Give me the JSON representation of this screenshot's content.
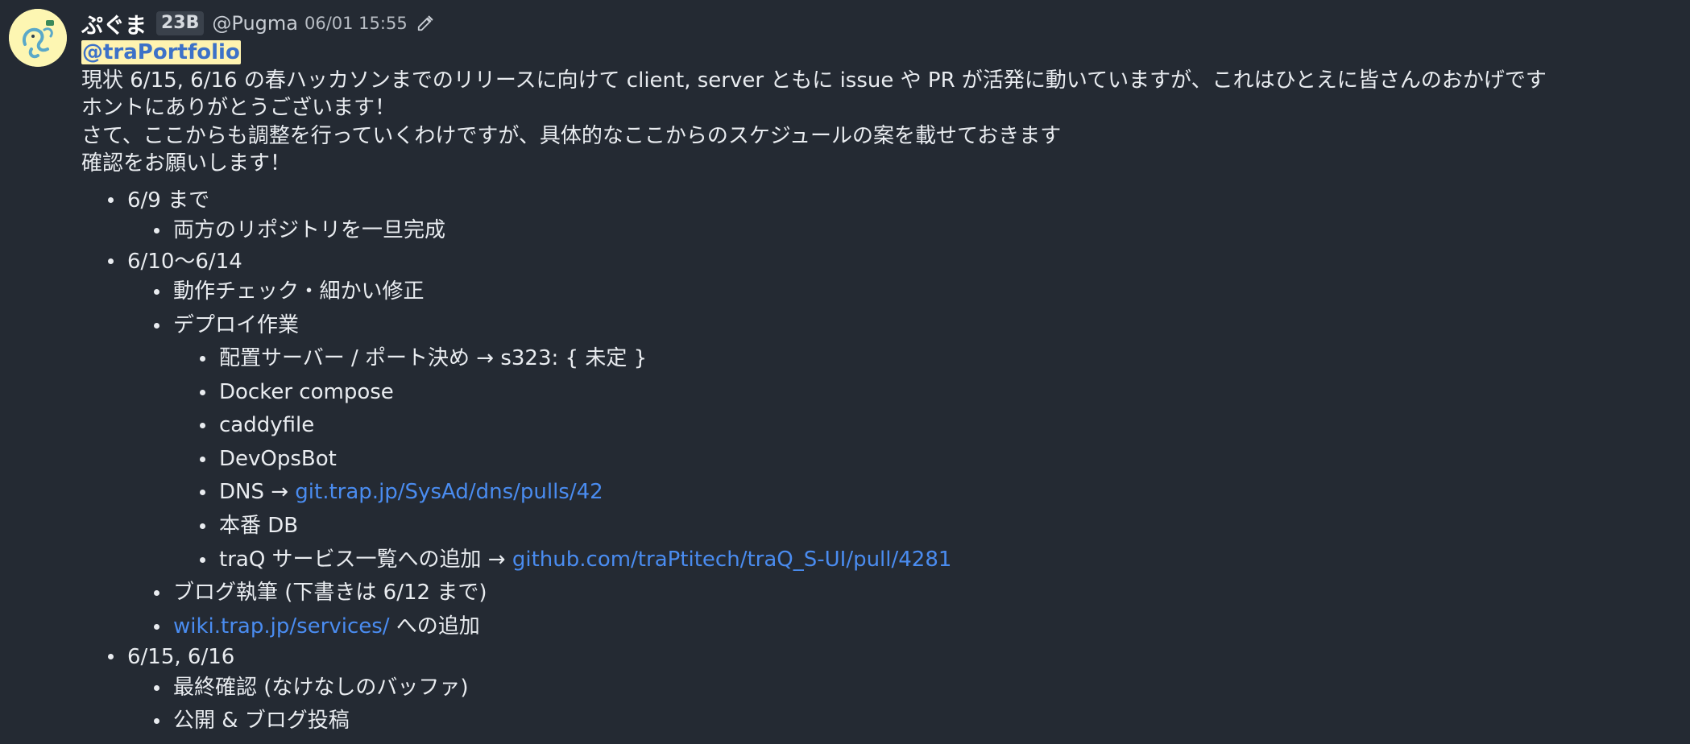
{
  "message": {
    "author": {
      "display_name": "ぷぐま",
      "grade": "23B",
      "user_id": "@Pugma"
    },
    "timestamp": "06/01 15:55",
    "icons": {
      "edited": "pencil-icon",
      "avatar": "pug-avatar"
    },
    "colors": {
      "background": "#242a33",
      "link": "#4a8cf0",
      "mention_bg": "#fff3b0",
      "mention_text": "#3d71c8",
      "avatar_bg": "#fdf6b2"
    },
    "mention": "@traPortfolio",
    "lines": [
      "現状 6/15, 6/16 の春ハッカソンまでのリリースに向けて client, server ともに issue や PR が活発に動いていますが、これはひとえに皆さんのおかげです",
      "ホントにありがとうございます！",
      "さて、ここからも調整を行っていくわけですが、具体的なここからのスケジュールの案を載せておきます",
      "確認をお願いします！"
    ],
    "schedule": {
      "p1": {
        "label": "6/9 まで",
        "items": [
          "両方のリポジトリを一旦完成"
        ]
      },
      "p2": {
        "label": "6/10〜6/14",
        "check": "動作チェック・細かい修正",
        "deploy": {
          "label": "デプロイ作業",
          "server": "配置サーバー / ポート決め → s323: { 未定 }",
          "docker": "Docker compose",
          "caddy": "caddyfile",
          "devops": "DevOpsBot",
          "dns_prefix": "DNS → ",
          "dns_link": "git.trap.jp/SysAd/dns/pulls/42",
          "db": "本番 DB",
          "traq_prefix": "traQ サービス一覧への追加 → ",
          "traq_link": "github.com/traPtitech/traQ_S-UI/pull/4281"
        },
        "blog": "ブログ執筆 (下書きは 6/12 まで)",
        "wiki_link": "wiki.trap.jp/services/",
        "wiki_suffix": " への追加"
      },
      "p3": {
        "label": "6/15, 6/16",
        "final": "最終確認 (なけなしのバッファ)",
        "publish": "公開 & ブログ投稿"
      }
    }
  }
}
